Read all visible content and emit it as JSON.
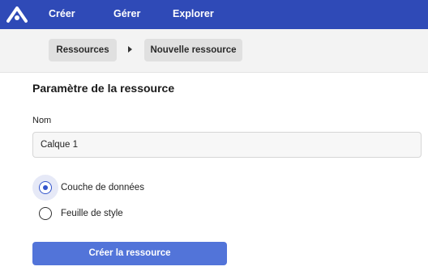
{
  "topbar": {
    "logo_icon": "brand-logo-icon",
    "nav": [
      "Créer",
      "Gérer",
      "Explorer"
    ],
    "color": "#2f4ab7"
  },
  "breadcrumb": {
    "items": [
      "Ressources",
      "Nouvelle ressource"
    ],
    "separator_icon": "chevron-right-icon"
  },
  "form": {
    "title": "Paramètre de la ressource",
    "name_label": "Nom",
    "name_value": "Calque 1",
    "resource_type": {
      "options": [
        "Couche de données",
        "Feuille de style"
      ],
      "selected": "Couche de données"
    },
    "submit_label": "Créer la ressource"
  },
  "colors": {
    "accent": "#3355cc",
    "button": "#5274d9",
    "breadcrumb_bar": "#f3f3f3"
  }
}
